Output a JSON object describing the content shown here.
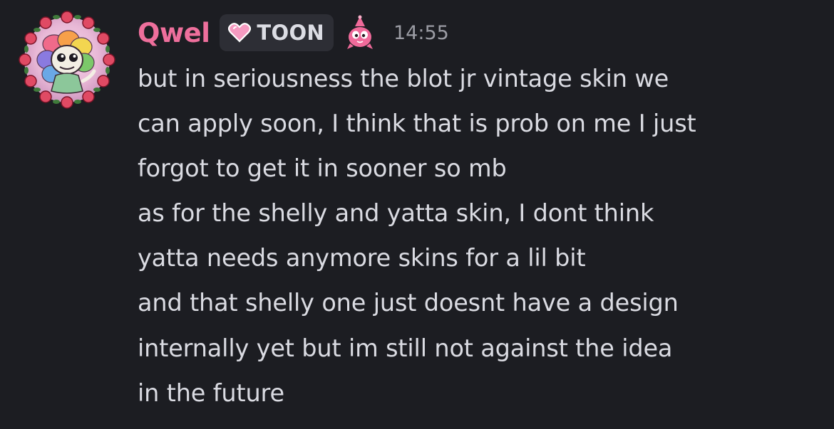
{
  "message": {
    "author": "Qwel",
    "server_tag": "TOON",
    "timestamp": "14:55",
    "lines": [
      "but in seriousness the blot jr vintage skin we",
      "can apply soon, I think that is prob on me I just",
      "forgot to get it in sooner so mb",
      "as for the shelly and yatta skin, I dont think",
      "yatta needs anymore skins for a lil bit",
      "and that shelly one just doesnt have a design",
      "internally yet but im still not against the idea",
      "in the future"
    ]
  },
  "icons": {
    "avatar": "flower-character-avatar",
    "tag_badge": "pink-heart-icon",
    "role_badge": "pink-cone-creature-icon"
  },
  "colors": {
    "background": "#1c1d22",
    "username": "#ee6f9c",
    "tag_background": "#2d2e35",
    "tag_text": "#dcdde4",
    "message_text": "#dadbe2",
    "timestamp": "#9b9ca4",
    "accent_pink": "#f06a9a"
  }
}
